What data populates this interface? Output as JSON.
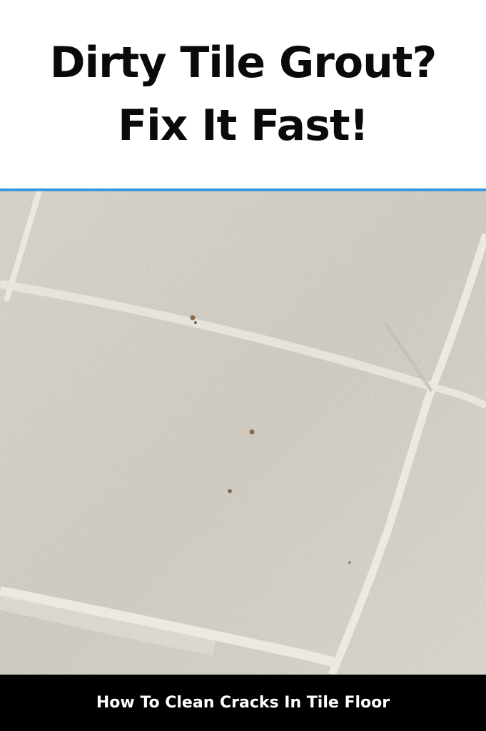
{
  "headline": {
    "line1": "Dirty Tile Grout?",
    "line2": "Fix It Fast!"
  },
  "image": {
    "subject": "tile-floor-photo"
  },
  "footer": {
    "caption": "How To Clean Cracks In Tile Floor"
  },
  "colors": {
    "divider": "#3a9ad9",
    "footer_bg": "#000000",
    "tile": "#d6d2ca",
    "grout": "#ece9e2"
  }
}
